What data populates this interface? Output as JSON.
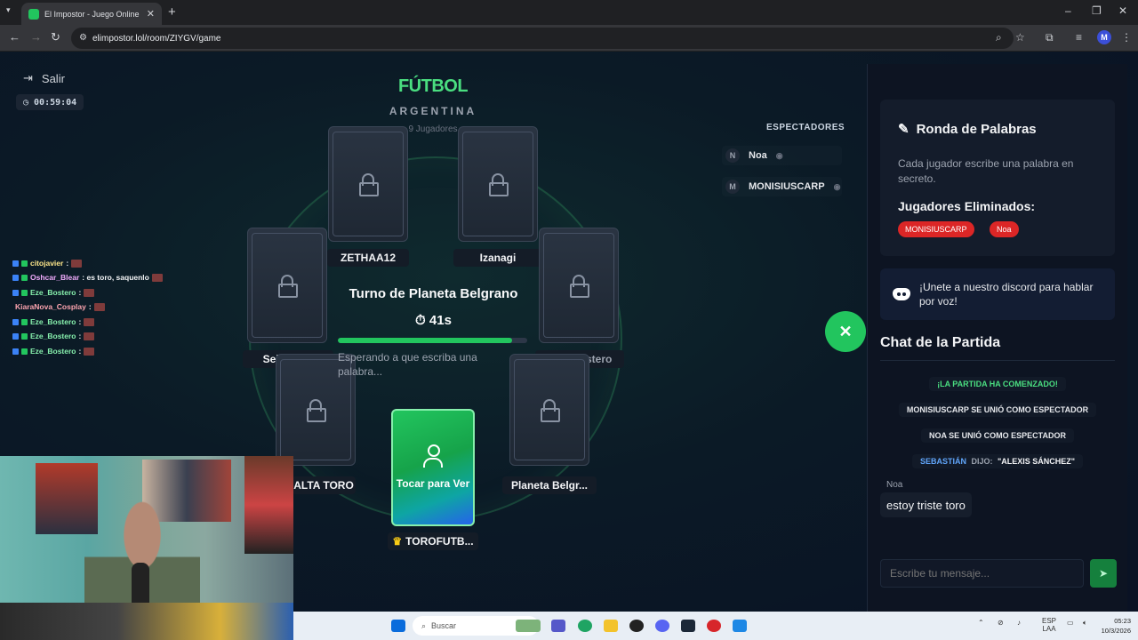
{
  "browser": {
    "tab_title": "El Impostor - Juego Online Gra",
    "url": "elimpostor.lol/room/ZIYGV/game",
    "profile_initial": "M"
  },
  "game": {
    "exit_label": "Salir",
    "elapsed": "00:59:04",
    "category": "FÚTBOL",
    "subcategory": "ARGENTINA",
    "players_count": "9 Jugadores",
    "turn_text": "Turno de Planeta Belgrano",
    "seconds_left": "41s",
    "progress": 0.92,
    "waiting_text": "Esperando a que escriba una palabra...",
    "my_card_label": "Tocar para Ver",
    "players": {
      "p_top_left": "ZETHAA12",
      "p_top_right": "Izanagi",
      "p_left": "Sebastián",
      "p_right": "Eze_Bostero",
      "p_bottom_left": "ALTA TORO",
      "p_bottom_right": "Planeta Belgr...",
      "p_me": "TOROFUTB..."
    }
  },
  "spectators": {
    "title": "ESPECTADORES",
    "list": [
      {
        "initial": "N",
        "name": "Noa"
      },
      {
        "initial": "M",
        "name": "MONISIUSCARP"
      }
    ]
  },
  "panel": {
    "ronda_title": "Ronda de Palabras",
    "ronda_desc": "Cada jugador escribe una palabra en secreto.",
    "eliminated_title": "Jugadores Eliminados:",
    "eliminated": [
      "MONISIUSCARP",
      "Noa"
    ],
    "discord_text": "¡Unete a nuestro discord para hablar por voz!",
    "chat_title": "Chat de la Partida",
    "system_msgs": [
      "¡LA PARTIDA HA COMENZADO!",
      "MONISIUSCARP SE UNIÓ COMO ESPECTADOR",
      "NOA SE UNIÓ COMO ESPECTADOR"
    ],
    "said_user": "SEBASTIÁN",
    "said_verb": "DIJO:",
    "said_word": "\"ALEXIS SÁNCHEZ\"",
    "msg_author": "Noa",
    "msg_text": "estoy triste toro",
    "input_placeholder": "Escribe tu mensaje..."
  },
  "stream_chat": [
    {
      "user": "citojavier",
      "text": ":",
      "color": "#fde68a"
    },
    {
      "user": "Oshcar_Blear",
      "text": ": es toro, saquenlo",
      "color": "#f0abfc"
    },
    {
      "user": "Eze_Bostero",
      "text": ":",
      "color": "#86efac"
    },
    {
      "user": "KiaraNova_Cosplay",
      "text": ":",
      "color": "#fda4af"
    },
    {
      "user": "Eze_Bostero",
      "text": ":",
      "color": "#86efac"
    },
    {
      "user": "Eze_Bostero",
      "text": ":",
      "color": "#86efac"
    },
    {
      "user": "Eze_Bostero",
      "text": ":",
      "color": "#86efac"
    }
  ],
  "taskbar": {
    "search_label": "Buscar",
    "lang": "ESP",
    "lang2": "LAA",
    "time": "05:23",
    "date": "10/3/2026"
  }
}
